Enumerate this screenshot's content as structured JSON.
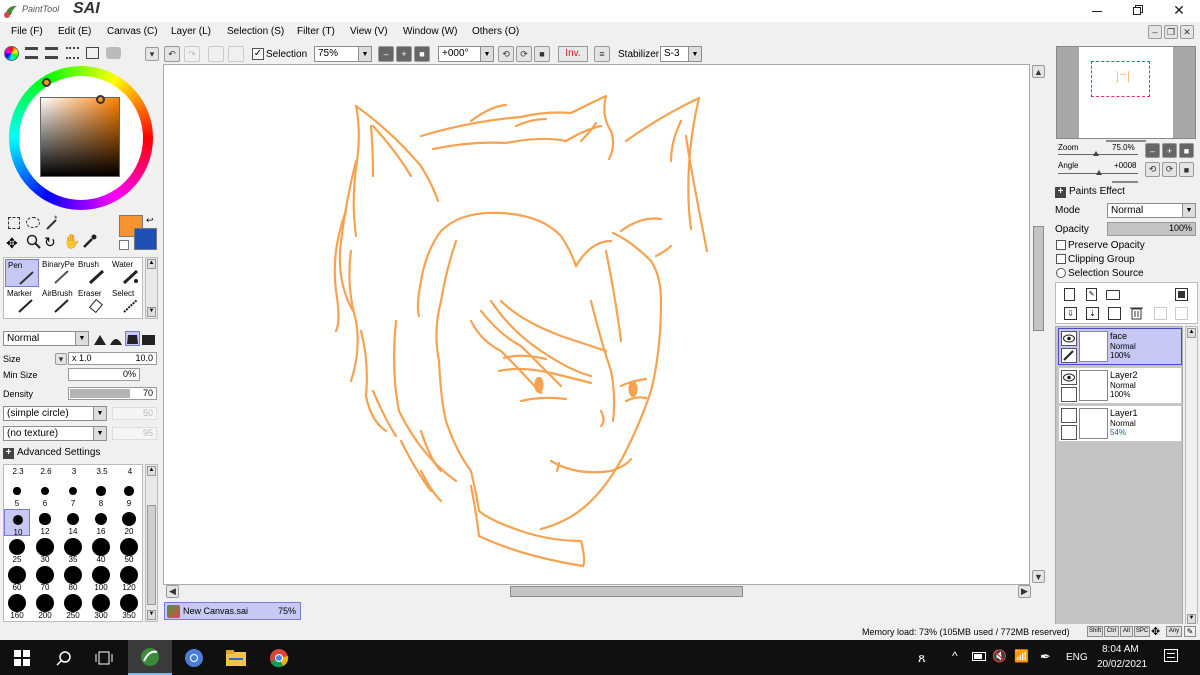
{
  "app": {
    "title_small": "PaintTool",
    "title_big": "SAI"
  },
  "menu": [
    "File (F)",
    "Edit (E)",
    "Canvas (C)",
    "Layer (L)",
    "Selection (S)",
    "Filter (T)",
    "View (V)",
    "Window (W)",
    "Others (O)"
  ],
  "toolbar": {
    "selection_label": "Selection",
    "selection_checked": true,
    "zoom": "75%",
    "angle": "+000°",
    "inv_label": "Inv.",
    "stabilizer_label": "Stabilizer",
    "stabilizer_value": "S-3"
  },
  "tools": {
    "brushes": [
      "Pen",
      "BinaryPe",
      "Brush",
      "Water",
      "Marker",
      "AirBrush",
      "Eraser",
      "Select"
    ],
    "blend_mode": "Normal",
    "size_label": "Size",
    "size_mult": "x 1.0",
    "size_value": "10.0",
    "min_size_label": "Min Size",
    "min_size_value": "0%",
    "density_label": "Density",
    "density_value": "70",
    "shape": "(simple circle)",
    "shape_value": "50",
    "texture": "(no texture)",
    "texture_value": "95",
    "advanced_label": "Advanced Settings",
    "brush_sizes_row1": [
      "2.3",
      "2.6",
      "3",
      "3.5",
      "4"
    ],
    "brush_sizes": [
      "5",
      "6",
      "7",
      "8",
      "9",
      "10",
      "12",
      "14",
      "16",
      "20",
      "25",
      "30",
      "35",
      "40",
      "50",
      "60",
      "70",
      "80",
      "100",
      "120",
      "160",
      "200",
      "250",
      "300",
      "350"
    ],
    "selected_size": "10",
    "primary_color": "#f7932e",
    "secondary_color": "#1e4fb5"
  },
  "navigator": {
    "zoom_label": "Zoom",
    "zoom_value": "75.0%",
    "angle_label": "Angle",
    "angle_value": "+0008"
  },
  "layer_panel": {
    "paints_effect": "Paints Effect",
    "mode_label": "Mode",
    "mode_value": "Normal",
    "opacity_label": "Opacity",
    "opacity_value": "100%",
    "preserve_opacity": "Preserve Opacity",
    "clipping_group": "Clipping Group",
    "selection_source": "Selection Source",
    "layers": [
      {
        "name": "face",
        "mode": "Normal",
        "opacity": "100%",
        "selected": true
      },
      {
        "name": "Layer2",
        "mode": "Normal",
        "opacity": "100%",
        "selected": false
      },
      {
        "name": "Layer1",
        "mode": "Normal",
        "opacity": "54%",
        "selected": false
      }
    ]
  },
  "canvas_tab": {
    "name": "New Canvas.sai",
    "zoom": "75%"
  },
  "status": {
    "memory": "Memory load: 73% (105MB used / 772MB reserved)",
    "keys": [
      "Shift",
      "Ctrl",
      "Alt",
      "SPC"
    ],
    "any_label": "Any"
  },
  "taskbar": {
    "lang": "ENG",
    "time": "8:04 AM",
    "date": "20/02/2021"
  },
  "colors": {
    "accent": "#3e77d8",
    "stroke": "#f7a250",
    "selection_bg": "#c8c8f5"
  }
}
